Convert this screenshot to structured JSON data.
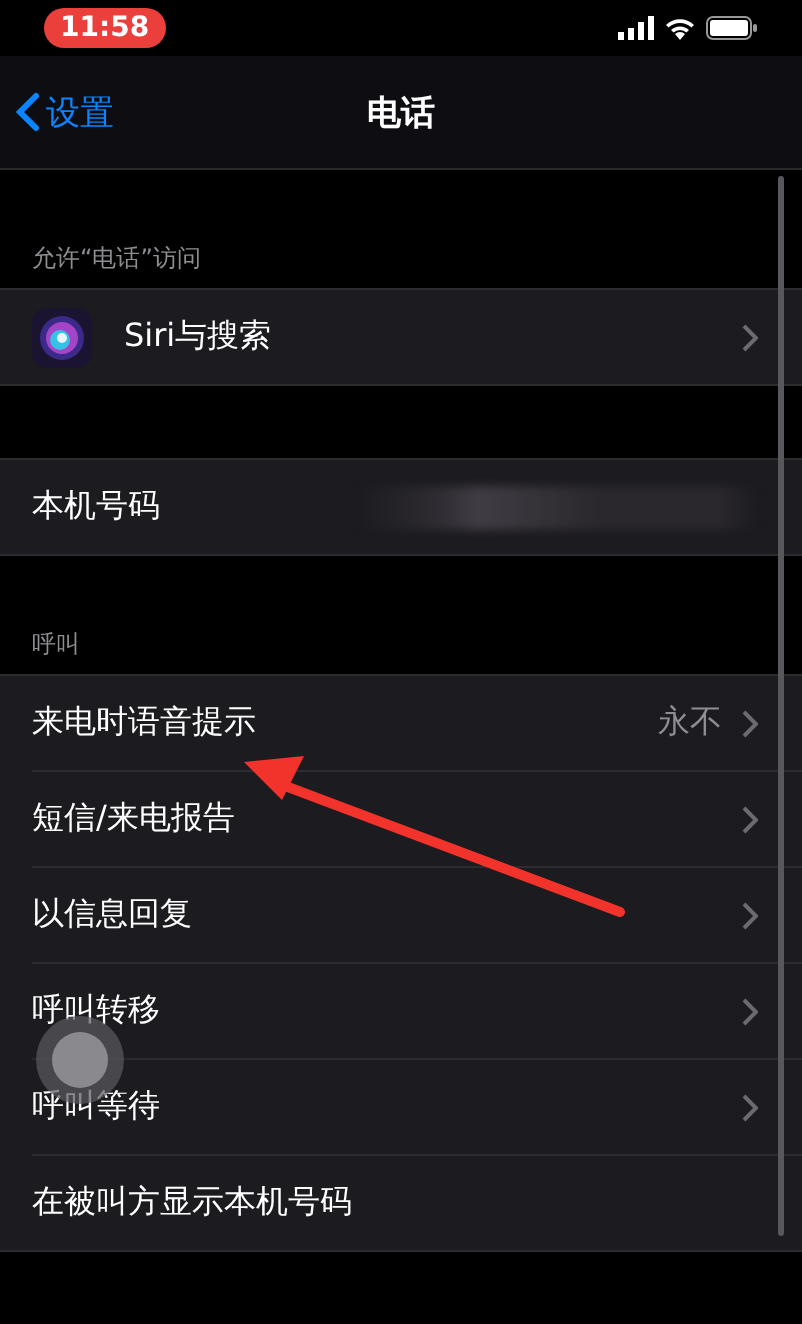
{
  "status_bar": {
    "time": "11:58",
    "time_highlighted": true
  },
  "nav": {
    "back": "设置",
    "title": "电话"
  },
  "sections": [
    {
      "header": "允许“电话”访问",
      "rows": [
        {
          "kind": "siri",
          "label": "Siri与搜索"
        }
      ]
    },
    {
      "rows": [
        {
          "kind": "blurred",
          "label": "本机号码"
        }
      ]
    },
    {
      "header": "呼叫",
      "rows": [
        {
          "kind": "link",
          "label": "来电时语音提示",
          "value": "永不"
        },
        {
          "kind": "link",
          "label": "短信/来电报告"
        },
        {
          "kind": "link",
          "label": "以信息回复"
        },
        {
          "kind": "link",
          "label": "呼叫转移"
        },
        {
          "kind": "link",
          "label": "呼叫等待"
        },
        {
          "kind": "plain",
          "label": "在被叫方显示本机号码"
        }
      ]
    }
  ]
}
